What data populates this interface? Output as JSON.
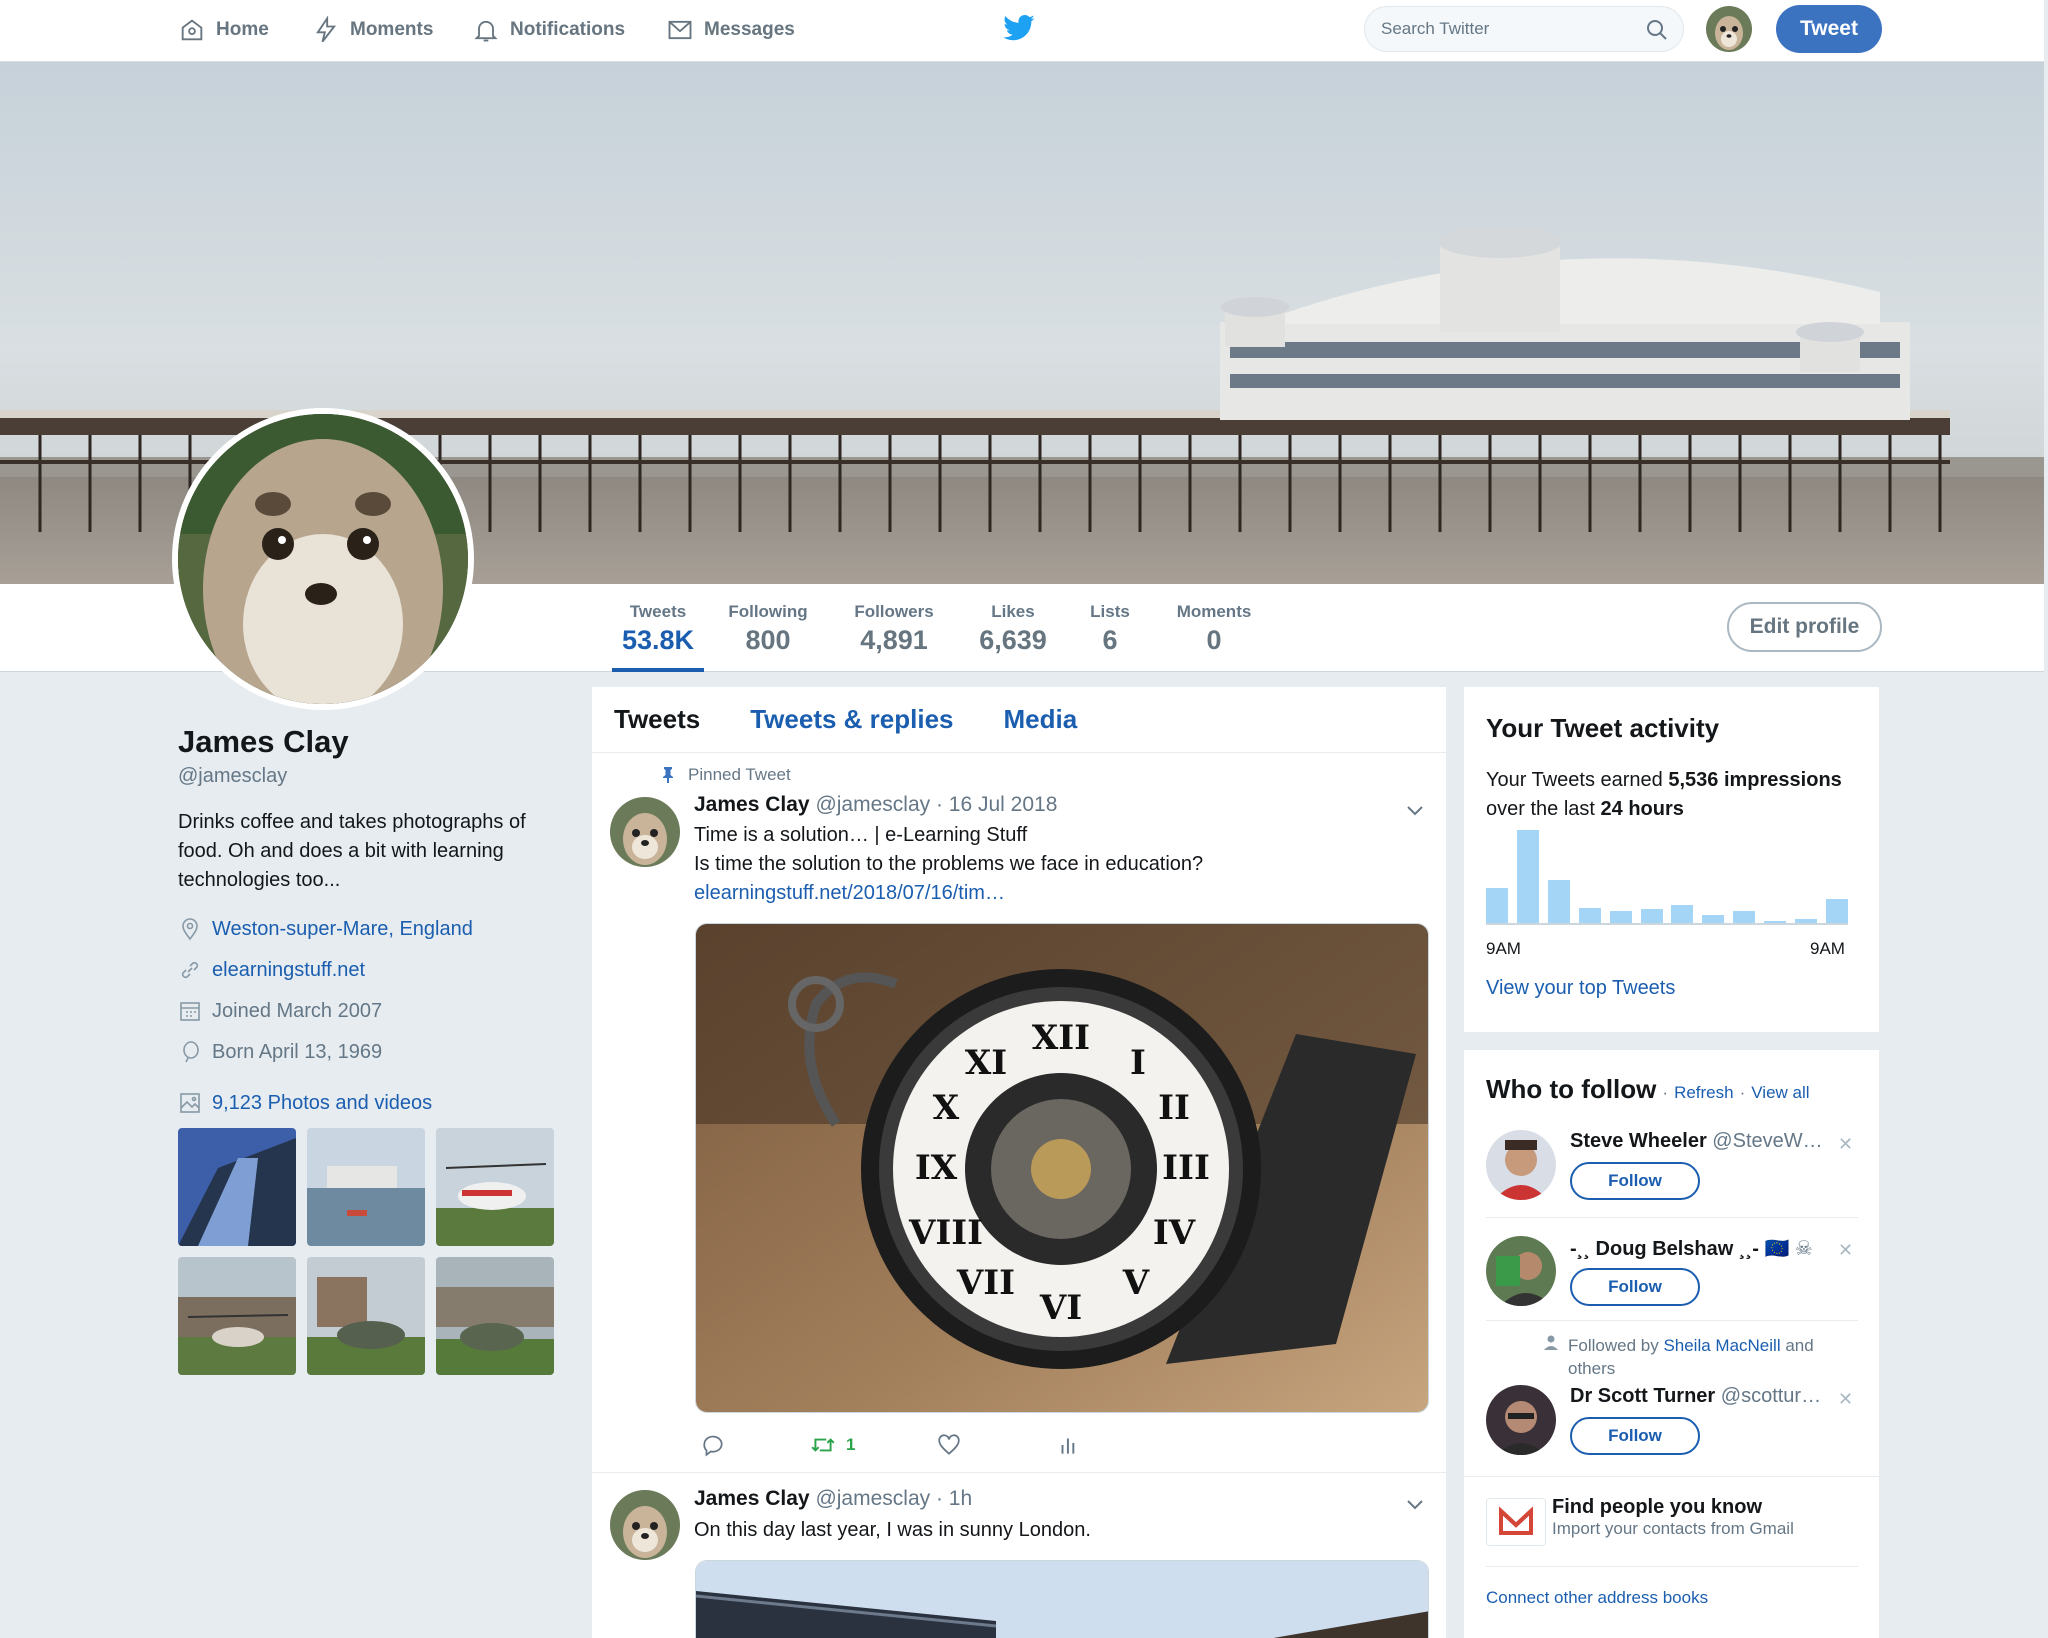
{
  "nav": {
    "home": "Home",
    "moments": "Moments",
    "notifications": "Notifications",
    "messages": "Messages",
    "search_placeholder": "Search Twitter",
    "tweet_button": "Tweet"
  },
  "stats": [
    {
      "label": "Tweets",
      "value": "53.8K"
    },
    {
      "label": "Following",
      "value": "800"
    },
    {
      "label": "Followers",
      "value": "4,891"
    },
    {
      "label": "Likes",
      "value": "6,639"
    },
    {
      "label": "Lists",
      "value": "6"
    },
    {
      "label": "Moments",
      "value": "0"
    }
  ],
  "edit_profile": "Edit profile",
  "profile": {
    "name": "James Clay",
    "handle": "@jamesclay",
    "bio": "Drinks coffee and takes photographs of food. Oh and does a bit with learning technologies too...",
    "location": "Weston-super-Mare, England",
    "website": "elearningstuff.net",
    "joined": "Joined March 2007",
    "born": "Born April 13, 1969",
    "photos": "9,123 Photos and videos"
  },
  "timeline": {
    "tabs": [
      "Tweets",
      "Tweets & replies",
      "Media"
    ],
    "pinned_label": "Pinned Tweet",
    "tweets": [
      {
        "name": "James Clay",
        "handle": "@jamesclay",
        "time": "· 16 Jul 2018",
        "line1": "Time is a solution… | e-Learning Stuff",
        "line2": "Is time the solution to the problems we face in education?",
        "link": "elearningstuff.net/2018/07/16/tim…",
        "retweets": "1"
      },
      {
        "name": "James Clay",
        "handle": "@jamesclay",
        "time": "· 1h",
        "line1": "On this day last year, I was in sunny London."
      }
    ]
  },
  "activity": {
    "title": "Your Tweet activity",
    "text_pre": "Your Tweets earned ",
    "impressions": "5,536 impressions",
    "text_mid": "over the last ",
    "hours": "24 hours",
    "axis_left": "9AM",
    "axis_right": "9AM",
    "bars": [
      0.38,
      1.0,
      0.46,
      0.16,
      0.13,
      0.15,
      0.19,
      0.09,
      0.13,
      0.02,
      0.04,
      0.26
    ],
    "link": "View your top Tweets"
  },
  "who_to_follow": {
    "title": "Who to follow",
    "refresh": "Refresh",
    "view_all": "View all",
    "dot": "·",
    "users": [
      {
        "name": "Steve Wheeler",
        "handle": "@SteveW…"
      },
      {
        "name": "-¸¸ Doug Belshaw ¸¸-",
        "handle": "🇪🇺 ☠"
      },
      {
        "name": "Dr Scott Turner",
        "handle": "@scottur…"
      }
    ],
    "follow": "Follow",
    "followed_by_pre": "Followed by ",
    "followed_by_name": "Sheila MacNeill",
    "followed_by_post": " and others",
    "find_title": "Find people you know",
    "find_sub": "Import your contacts from Gmail",
    "connect": "Connect other address books"
  },
  "colors": {
    "accent": "#1b5eb0",
    "tweet_button": "#3b73c1",
    "retweet": "#2ba34a",
    "bar": "#a4d5f7"
  }
}
